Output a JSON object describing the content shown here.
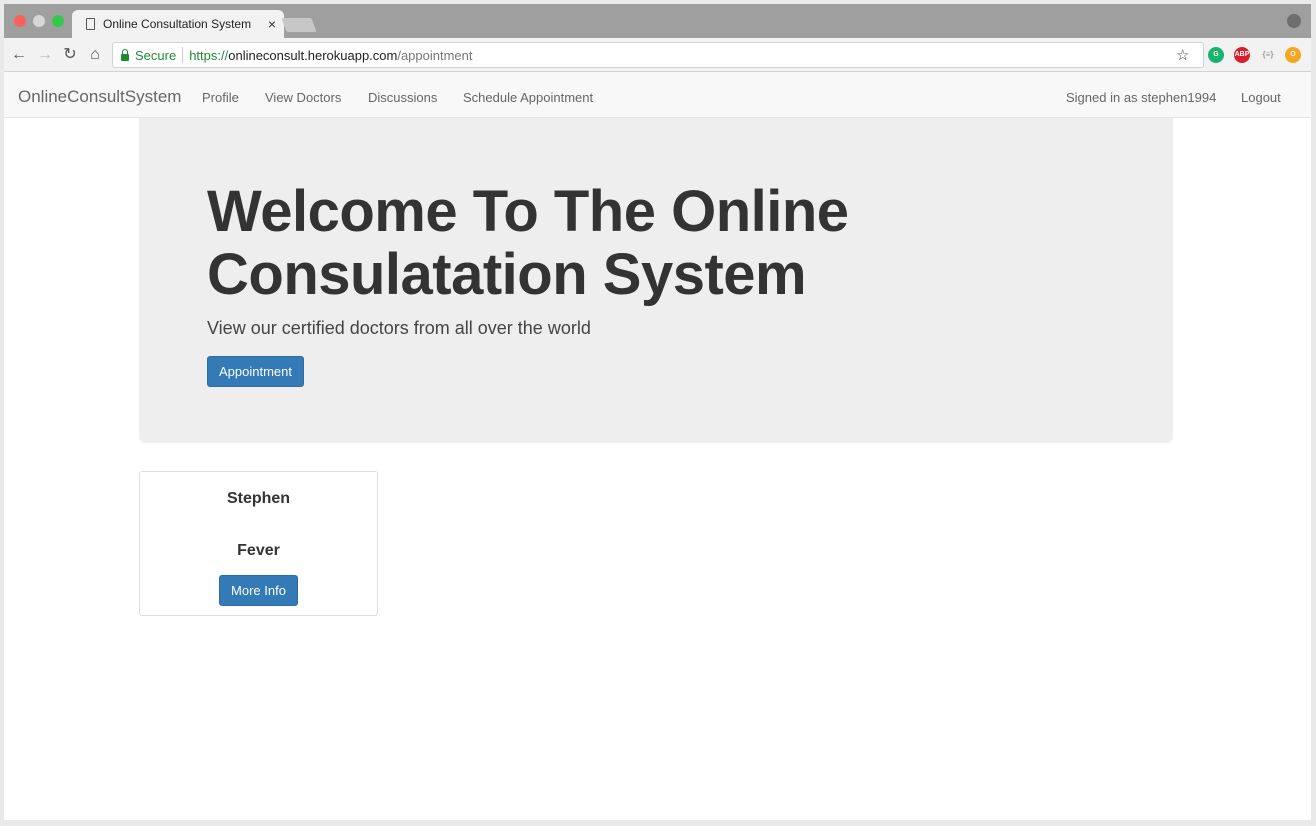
{
  "browser": {
    "tab_title": "Online Consultation System",
    "tab_close": "×",
    "omnibox": {
      "secure_label": "Secure",
      "url_scheme": "https://",
      "url_host": "onlineconsult.herokuapp.com",
      "url_path": "/appointment"
    },
    "extensions": {
      "grammarly": "G",
      "adblock": "ABP",
      "json": "{≡}",
      "other": "O"
    }
  },
  "navbar": {
    "brand": "OnlineConsultSystem",
    "links": [
      "Profile",
      "View Doctors",
      "Discussions",
      "Schedule Appointment"
    ],
    "signed_in": "Signed in as stephen1994",
    "logout": "Logout"
  },
  "jumbotron": {
    "title": "Welcome To The Online Consulatation System",
    "subtitle": "View our certified doctors from all over the world",
    "button": "Appointment"
  },
  "card": {
    "name": "Stephen",
    "condition": "Fever",
    "button": "More Info"
  },
  "colors": {
    "primary": "#337ab7",
    "jumbotron_bg": "#eeeeee",
    "navbar_bg": "#f8f8f8",
    "secure_green": "#1e8a36"
  }
}
